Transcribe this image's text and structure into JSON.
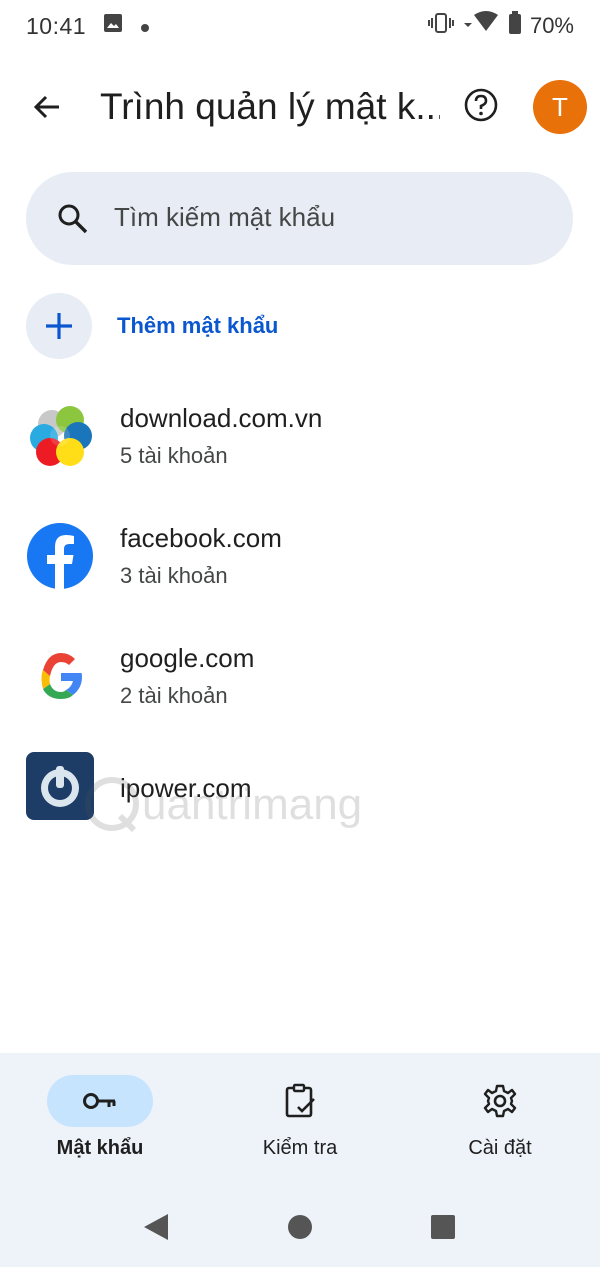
{
  "status_bar": {
    "time": "10:41",
    "battery": "70%"
  },
  "app_bar": {
    "title": "Trình quản lý mật k...",
    "avatar_letter": "T"
  },
  "search": {
    "placeholder": "Tìm kiếm mật khẩu"
  },
  "add_password": {
    "label": "Thêm mật khẩu"
  },
  "sites": [
    {
      "name": "download.com.vn",
      "count": "5 tài khoản"
    },
    {
      "name": "facebook.com",
      "count": "3 tài khoản"
    },
    {
      "name": "google.com",
      "count": "2 tài khoản"
    },
    {
      "name": "ipower.com",
      "count": ""
    }
  ],
  "watermark": {
    "text": "uantrimang"
  },
  "bottom_nav": {
    "items": [
      {
        "label": "Mật khẩu",
        "icon": "key-icon",
        "active": true
      },
      {
        "label": "Kiểm tra",
        "icon": "clipboard-check-icon",
        "active": false
      },
      {
        "label": "Cài đặt",
        "icon": "gear-icon",
        "active": false
      }
    ]
  },
  "colors": {
    "accent": "#0b57d0",
    "avatar": "#e8710a",
    "search_bg": "#e8edf5",
    "nav_active": "#c7e4ff"
  }
}
